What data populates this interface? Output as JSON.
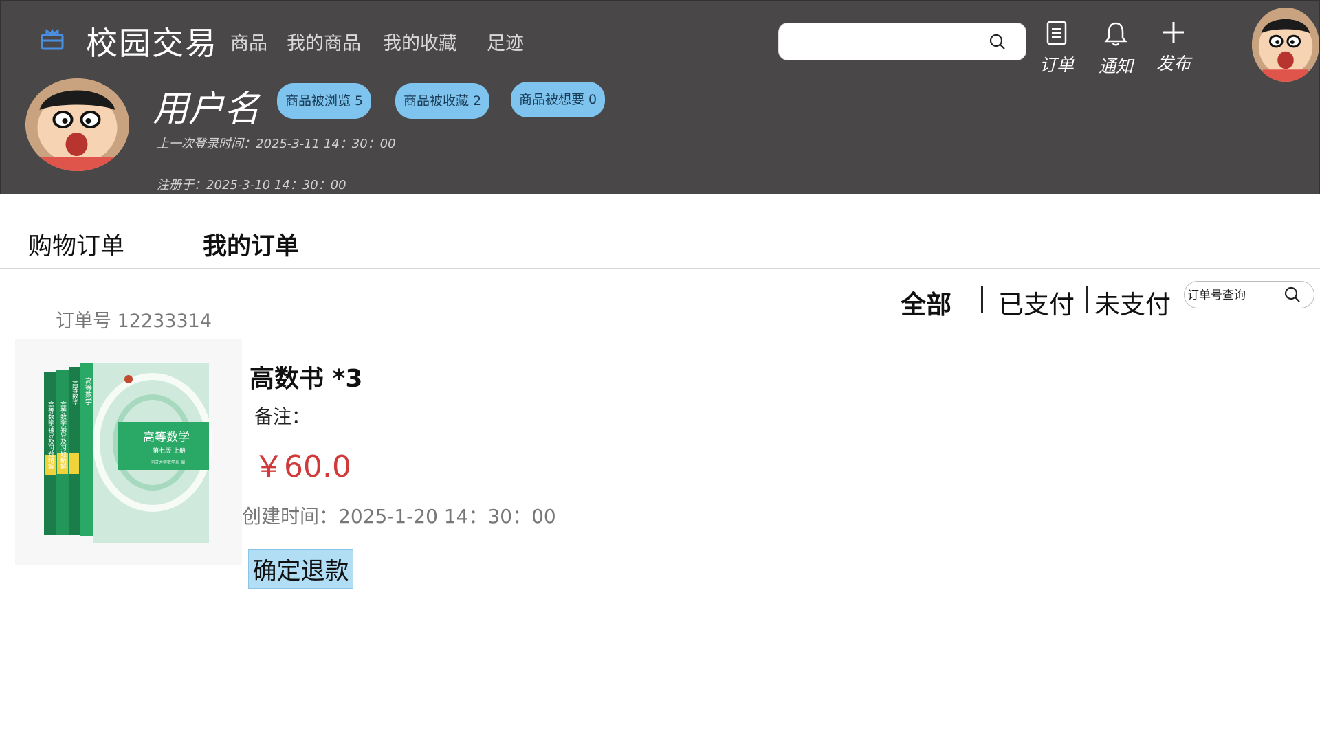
{
  "app": {
    "brand": "校园交易",
    "logo_icon": "gift-box-icon",
    "accent": "#4a90e2"
  },
  "nav": {
    "items": [
      {
        "label": "商品"
      },
      {
        "label": "我的商品"
      },
      {
        "label": "我的收藏"
      },
      {
        "label": "足迹"
      }
    ]
  },
  "search": {
    "placeholder": "",
    "icon": "search-icon"
  },
  "actions": {
    "orders": {
      "label": "订单",
      "icon": "document-icon"
    },
    "notify": {
      "label": "通知",
      "icon": "bell-icon"
    },
    "publish": {
      "label": "发布",
      "icon": "plus-icon"
    }
  },
  "profile": {
    "username": "用户名",
    "stats": [
      {
        "label": "商品被浏览 5"
      },
      {
        "label": "商品被收藏 2"
      },
      {
        "label": "商品被想要 0"
      }
    ],
    "last_login": "上一次登录时间：2025-3-11  14：30：00",
    "registered": "注册于：2025-3-10 14：30：00"
  },
  "tabs": [
    {
      "label": "购物订单",
      "active": false
    },
    {
      "label": "我的订单",
      "active": true
    }
  ],
  "filters": [
    {
      "label": "全部",
      "active": true
    },
    {
      "label": "已支付",
      "active": false
    },
    {
      "label": "未支付",
      "active": false
    }
  ],
  "order_search": {
    "placeholder": "订单号查询"
  },
  "order": {
    "order_no": "订单号 12233314",
    "product_name": "高数书 *3",
    "note": "备注：",
    "price": "￥60.0",
    "created": "创建时间：2025-1-20 14：30：00",
    "refund_label": "确定退款",
    "book_title": "高等数学",
    "book_edition": "第七版  上册",
    "book_publisher": "同济大学数学系 编",
    "spine_title": "高等数学辅导及习题精解"
  },
  "colors": {
    "header_bg": "#4a4749",
    "pill_bg": "#7ec4ee",
    "price": "#d03a3a",
    "refund_bg": "#b2def5"
  }
}
